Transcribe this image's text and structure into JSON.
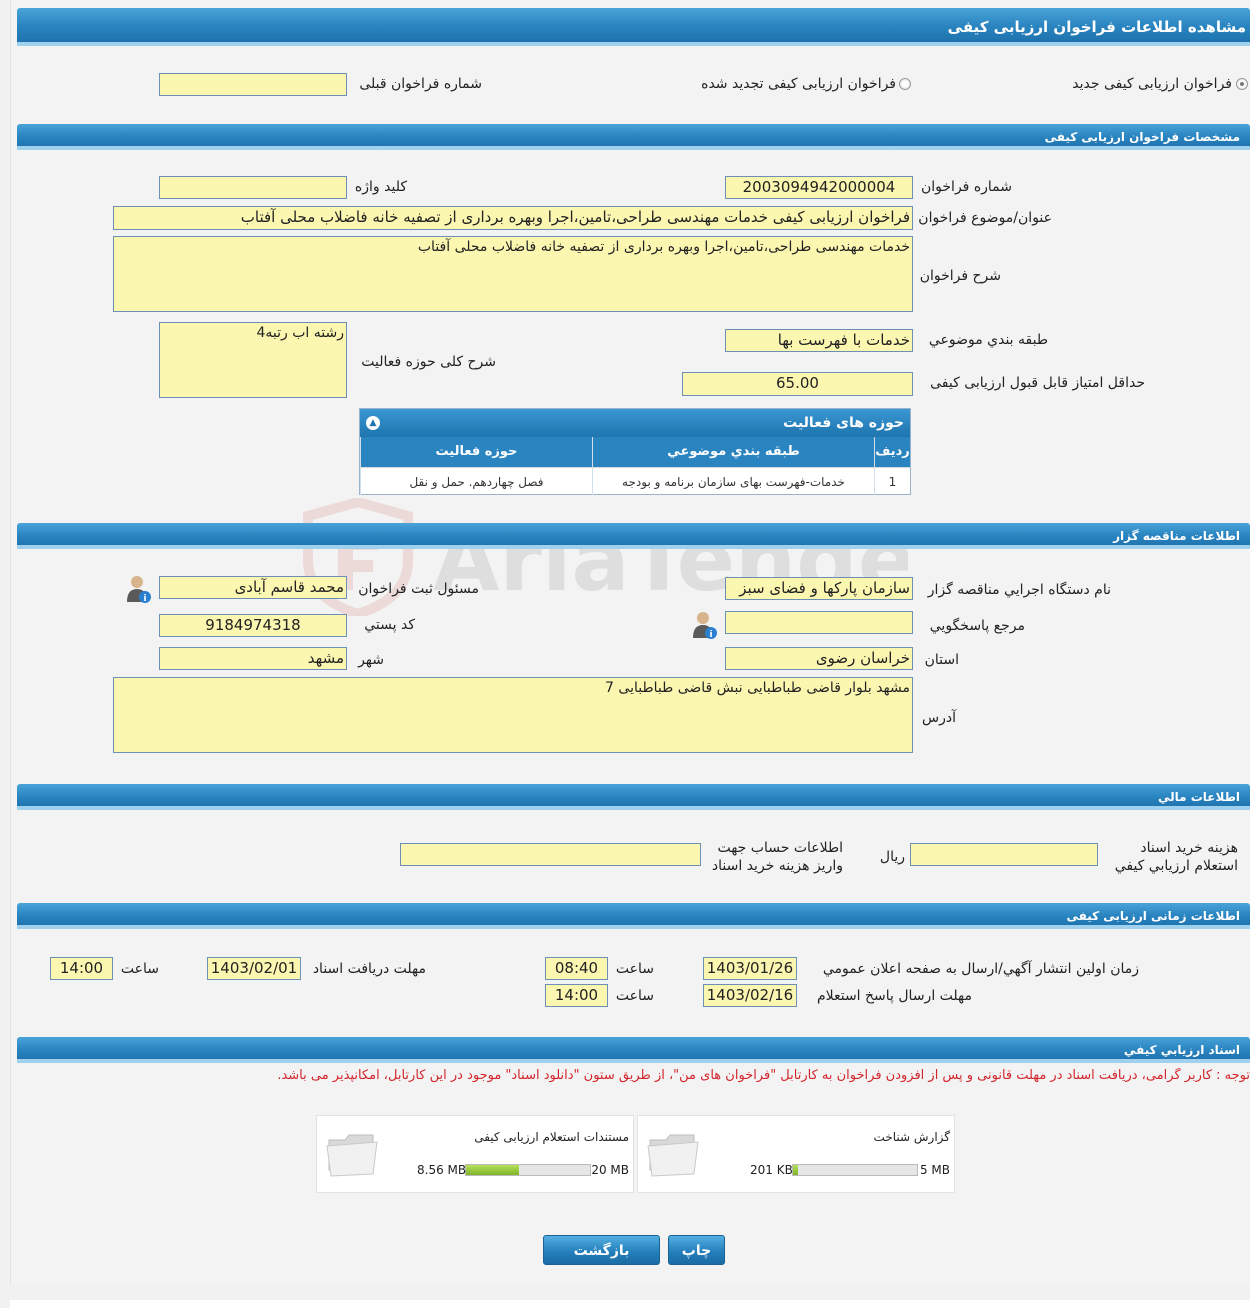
{
  "page_title": "مشاهده اطلاعات فراخوان ارزیابی کیفی",
  "call_type": {
    "option_new": "فراخوان ارزیابی کیفی جدید",
    "option_renewed": "فراخوان ارزیابی کیفی تجدید شده",
    "selected": "new",
    "previous_call_label": "شماره فراخوان قبلی",
    "previous_call_value": ""
  },
  "spec": {
    "section_title": "مشخصات فراخوان ارزیابی کیفی",
    "call_number_label": "شماره فراخوان",
    "call_number": "2003094942000004",
    "keyword_label": "کلید واژه",
    "keyword": "",
    "subject_label": "عنوان/موضوع فراخوان",
    "subject": "فراخوان ارزیابی کیفی خدمات مهندسی طراحی،تامین،اجرا وبهره برداری از تصفیه خانه فاضلاب محلی آفتاب",
    "description_label": "شرح فراخوان",
    "description": "خدمات مهندسی طراحی،تامین،اجرا وبهره برداری از تصفیه خانه فاضلاب محلی آفتاب",
    "category_label": "طبقه بندي موضوعي",
    "category": "خدمات با فهرست بها",
    "activity_desc_label": "شرح کلی حوزه فعالیت",
    "activity_desc": "رشته اب رتبه4",
    "min_score_label": "حداقل امتیاز قابل قبول ارزیابی کیفی",
    "min_score": "65.00"
  },
  "activity_grid": {
    "title": "حوزه های فعالیت",
    "col_row": "رديف",
    "col_category": "طبقه بندي موضوعي",
    "col_field": "حوزه فعالیت",
    "rows": [
      {
        "row": "1",
        "category": "خدمات-فهرست بهای سازمان برنامه و بودجه",
        "field": "فصل چهاردهم. حمل و نقل"
      }
    ]
  },
  "organizer": {
    "section_title": "اطلاعات مناقصه گزار",
    "org_label": "نام دستگاه اجرايي مناقصه گزار",
    "org": "سازمان پارکها و فضای سبز",
    "registrar_label": "مسئول ثبت فراخوان",
    "registrar": "محمد قاسم آبادی",
    "reference_label": "مرجع پاسخگويي",
    "reference": "",
    "postal_label": "کد پستي",
    "postal": "9184974318",
    "province_label": "استان",
    "province": "خراسان رضوی",
    "city_label": "شهر",
    "city": "مشهد",
    "address_label": "آدرس",
    "address": "مشهد بلوار قاضی طباطبایی  نبش قاضی طباطبایی 7"
  },
  "financial": {
    "section_title": "اطلاعات مالي",
    "doc_cost_label_1": "هزينه خريد اسناد",
    "doc_cost_label_2": "استعلام ارزيابي کيفي",
    "doc_cost": "",
    "currency": "ريال",
    "account_label_1": "اطلاعات حساب جهت",
    "account_label_2": "واريز هزينه خريد اسناد",
    "account": ""
  },
  "timing": {
    "section_title": "اطلاعات زمانی ارزیابی کیفی",
    "publish_label": "زمان اولين انتشار آگهي/ارسال به صفحه اعلان عمومي",
    "publish_date": "1403/01/26",
    "publish_time": "08:40",
    "time_label": "ساعت",
    "doc_deadline_label": "مهلت دريافت اسناد",
    "doc_deadline_date": "1403/02/01",
    "doc_deadline_time": "14:00",
    "reply_label": "مهلت ارسال پاسخ استعلام",
    "reply_date": "1403/02/16",
    "reply_time": "14:00"
  },
  "documents": {
    "section_title": "اسناد ارزيابي کيفي",
    "notice": "توجه : کاربر گرامی، دریافت اسناد در مهلت قانونی و پس از افزودن فراخوان به کارتابل \"فراخوان های من\"، از طریق ستون \"دانلود اسناد\" موجود در این کارتابل، امکانپذیر می باشد.",
    "files": [
      {
        "name": "گزارش شناخت",
        "total": "5 MB",
        "used": "201 KB",
        "fraction": 0.04
      },
      {
        "name": "مستندات استعلام ارزیابی کیفی",
        "total": "20 MB",
        "used": "8.56 MB",
        "fraction": 0.43
      }
    ]
  },
  "buttons": {
    "print": "چاپ",
    "back": "بازگشت"
  }
}
